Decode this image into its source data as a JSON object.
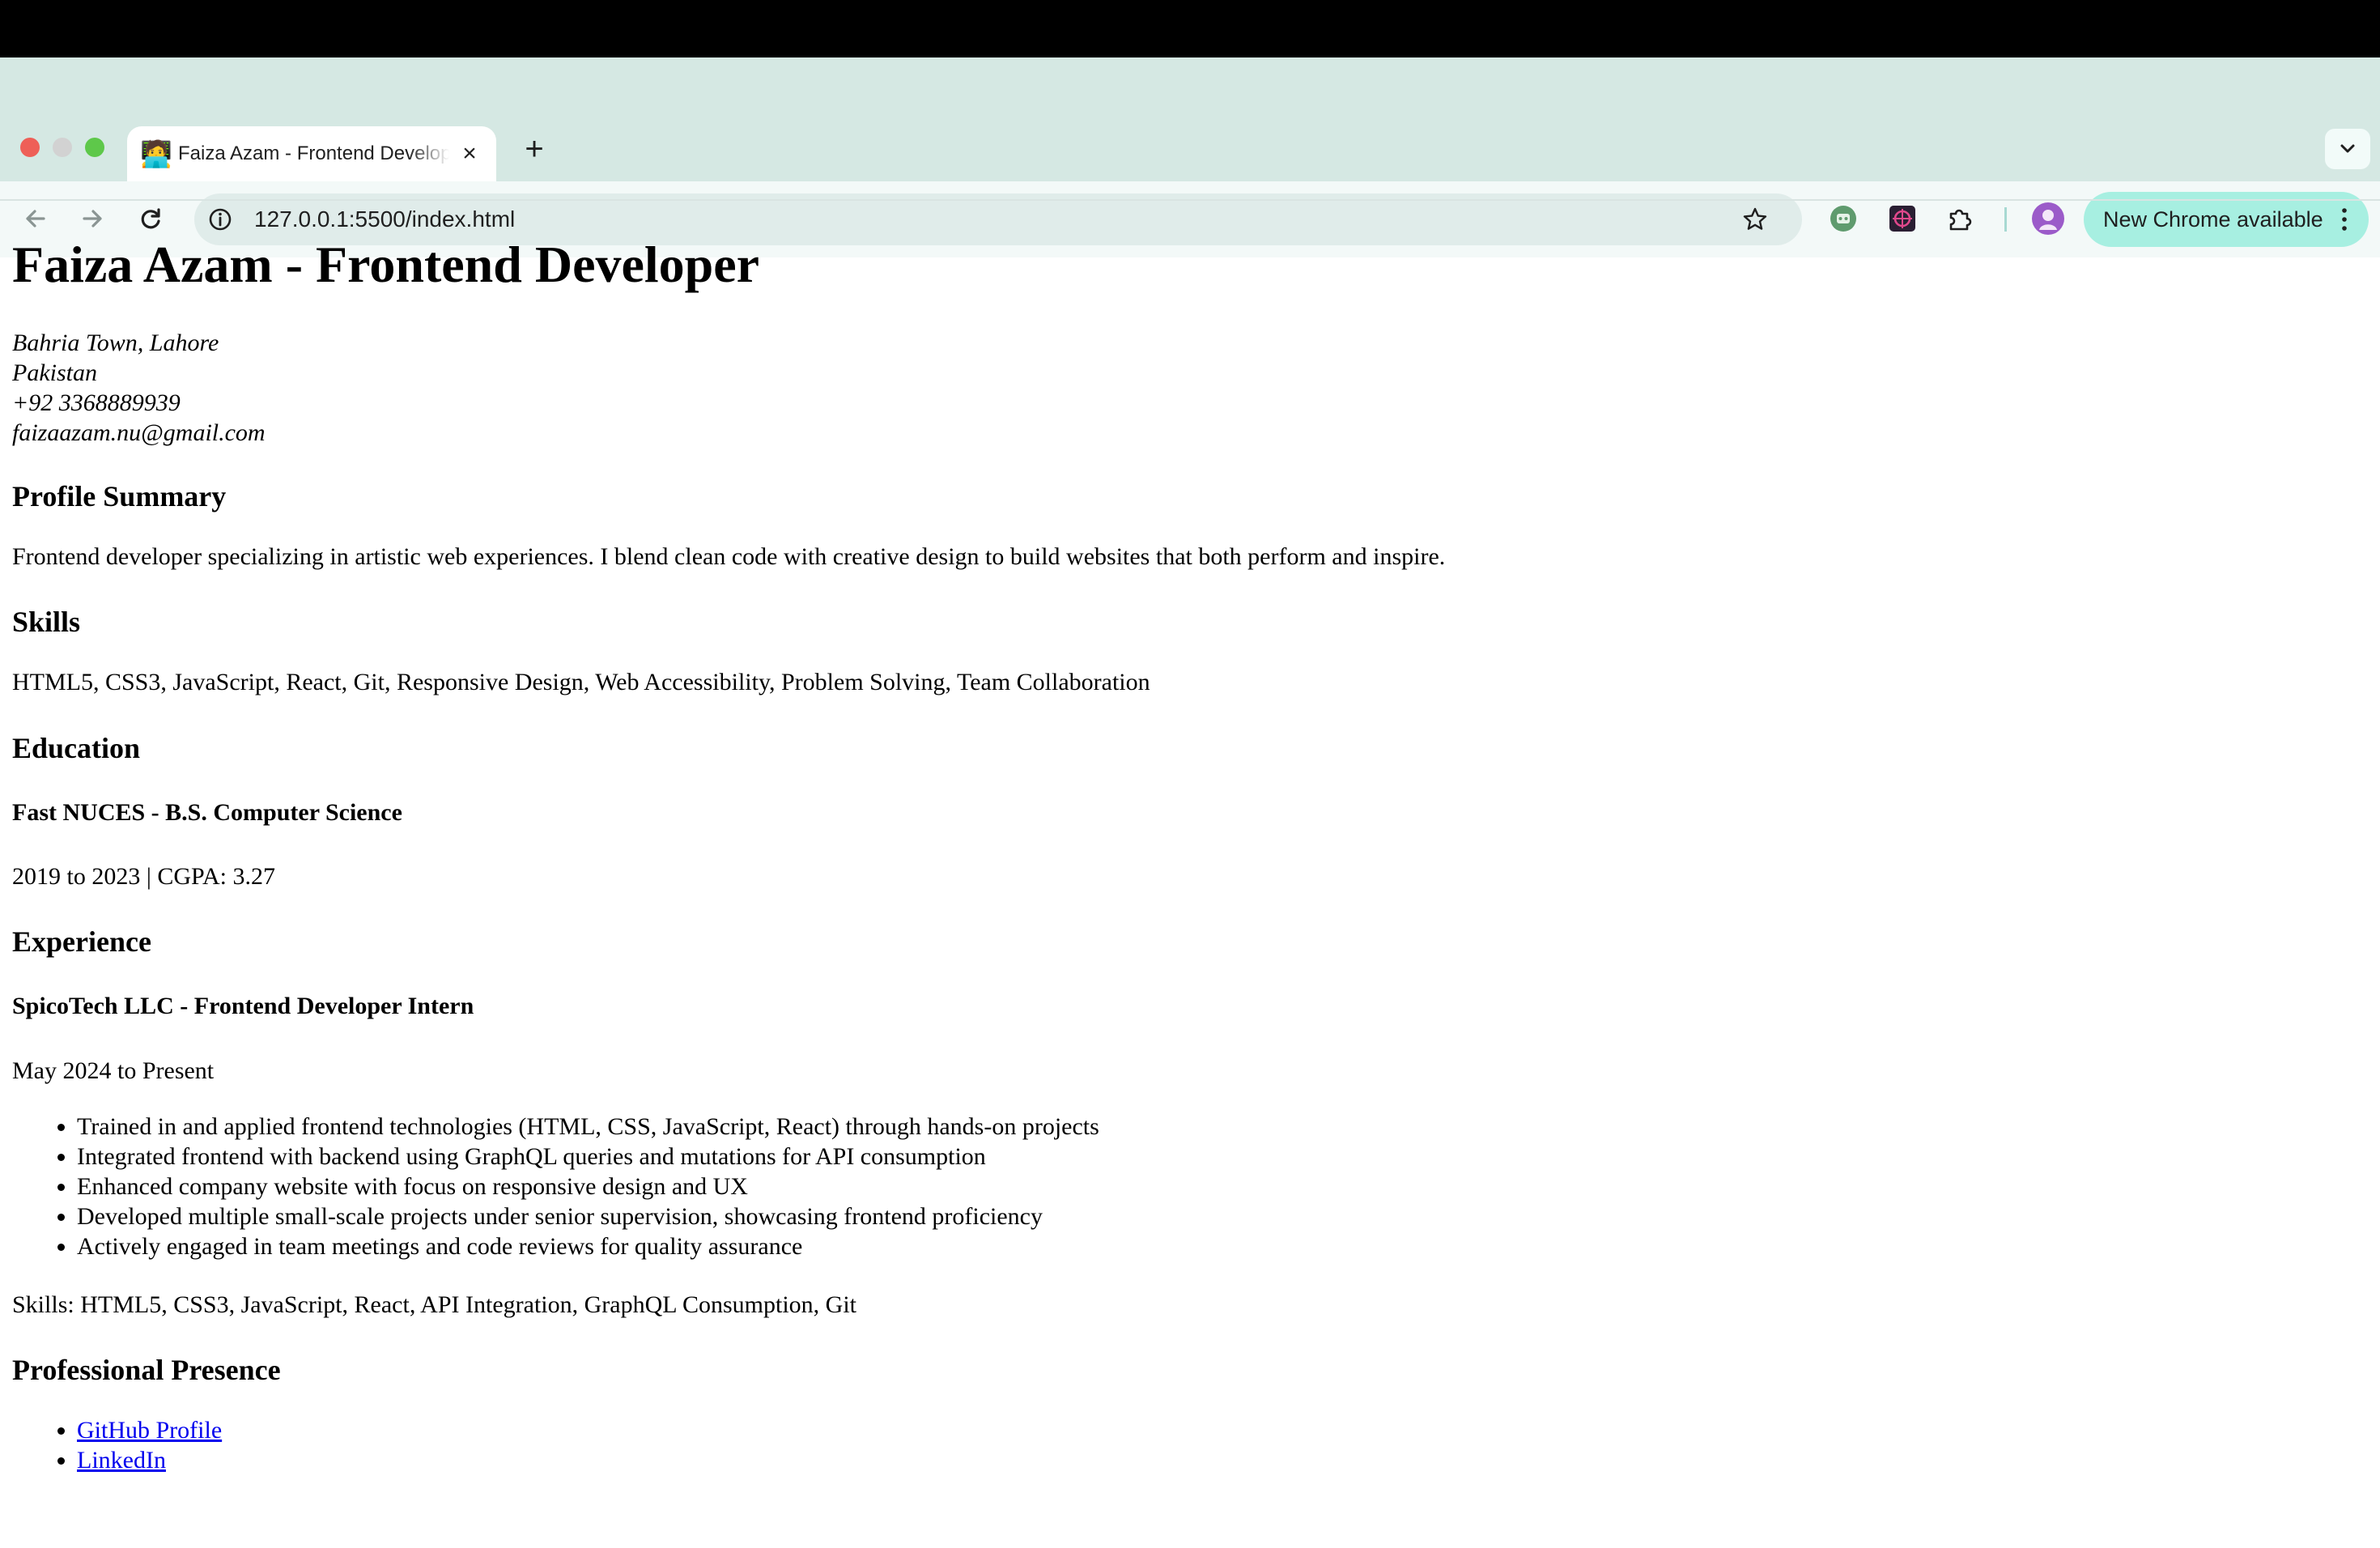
{
  "browser": {
    "tab": {
      "favicon": "🧑‍💻",
      "title": "Faiza Azam - Frontend Developer"
    },
    "address_bar": {
      "url": "127.0.0.1:5500/index.html"
    },
    "update_button": {
      "label": "New Chrome available"
    },
    "icons": [
      "back-arrow-icon",
      "forward-arrow-icon",
      "reload-icon",
      "site-info-icon",
      "bookmark-star-icon",
      "extension-icon",
      "puzzle-icon",
      "kebab-menu-icon"
    ]
  },
  "page": {
    "title": "Faiza Azam - Frontend Developer",
    "contact": {
      "address_line1": "Bahria Town, Lahore",
      "address_line2": "Pakistan",
      "phone": "+92 3368889939",
      "email": "faizaazam.nu@gmail.com"
    },
    "profile_summary": {
      "heading": "Profile Summary",
      "text": "Frontend developer specializing in artistic web experiences. I blend clean code with creative design to build websites that both perform and inspire."
    },
    "skills": {
      "heading": "Skills",
      "text": "HTML5, CSS3, JavaScript, React, Git, Responsive Design, Web Accessibility, Problem Solving, Team Collaboration"
    },
    "education": {
      "heading": "Education",
      "item_title": "Fast NUCES - B.S. Computer Science",
      "item_meta": "2019 to 2023 | CGPA: 3.27"
    },
    "experience": {
      "heading": "Experience",
      "item_title": "SpicoTech LLC - Frontend Developer Intern",
      "item_dates": "May 2024 to Present",
      "bullets": [
        "Trained in and applied frontend technologies (HTML, CSS, JavaScript, React) through hands-on projects",
        "Integrated frontend with backend using GraphQL queries and mutations for API consumption",
        "Enhanced company website with focus on responsive design and UX",
        "Developed multiple small-scale projects under senior supervision, showcasing frontend proficiency",
        "Actively engaged in team meetings and code reviews for quality assurance"
      ],
      "skills_line": "Skills: HTML5, CSS3, JavaScript, React, API Integration, GraphQL Consumption, Git"
    },
    "professional_presence": {
      "heading": "Professional Presence",
      "links": [
        "GitHub Profile",
        "LinkedIn"
      ]
    }
  },
  "colors": {
    "tab_strip": "#d5e8e3",
    "toolbar": "#f3f9f8",
    "omnibox": "#e0ecea",
    "update_button": "#a7efe1",
    "link": "#0000ee"
  }
}
